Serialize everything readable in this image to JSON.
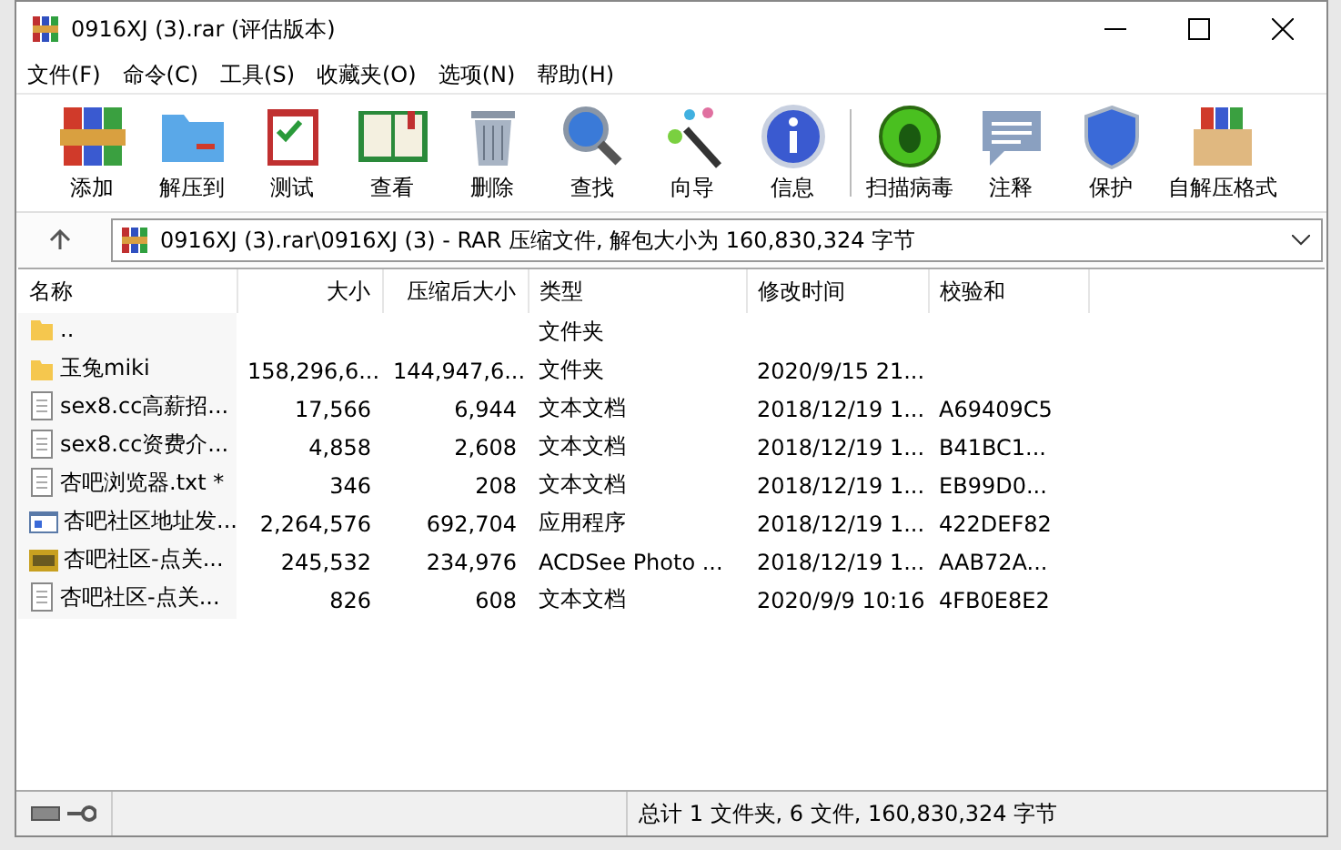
{
  "window": {
    "title": "0916XJ (3).rar (评估版本)"
  },
  "menu": [
    "文件(F)",
    "命令(C)",
    "工具(S)",
    "收藏夹(O)",
    "选项(N)",
    "帮助(H)"
  ],
  "toolbar": [
    {
      "label": "添加",
      "kind": "add"
    },
    {
      "label": "解压到",
      "kind": "extract"
    },
    {
      "label": "测试",
      "kind": "test"
    },
    {
      "label": "查看",
      "kind": "view"
    },
    {
      "label": "删除",
      "kind": "delete"
    },
    {
      "label": "查找",
      "kind": "find"
    },
    {
      "label": "向导",
      "kind": "wizard"
    },
    {
      "label": "信息",
      "kind": "info"
    },
    {
      "label": "扫描病毒",
      "kind": "scan"
    },
    {
      "label": "注释",
      "kind": "comment"
    },
    {
      "label": "保护",
      "kind": "protect"
    },
    {
      "label": "自解压格式",
      "kind": "sfx"
    }
  ],
  "address": {
    "value": "0916XJ (3).rar\\0916XJ (3) - RAR 压缩文件, 解包大小为 160,830,324 字节"
  },
  "table": {
    "columns": [
      "名称",
      "大小",
      "压缩后大小",
      "类型",
      "修改时间",
      "校验和"
    ],
    "rows": [
      {
        "kind": "folder",
        "name": "..",
        "size": "",
        "packed": "",
        "type": "文件夹",
        "modified": "",
        "crc": ""
      },
      {
        "kind": "folder",
        "name": "玉兔miki",
        "size": "158,296,6...",
        "packed": "144,947,6...",
        "type": "文件夹",
        "modified": "2020/9/15 21...",
        "crc": ""
      },
      {
        "kind": "text",
        "name": "sex8.cc高薪招...",
        "size": "17,566",
        "packed": "6,944",
        "type": "文本文档",
        "modified": "2018/12/19 1...",
        "crc": "A69409C5"
      },
      {
        "kind": "text",
        "name": "sex8.cc资费介...",
        "size": "4,858",
        "packed": "2,608",
        "type": "文本文档",
        "modified": "2018/12/19 1...",
        "crc": "B41BC1..."
      },
      {
        "kind": "text",
        "name": "杏吧浏览器.txt *",
        "size": "346",
        "packed": "208",
        "type": "文本文档",
        "modified": "2018/12/19 1...",
        "crc": "EB99D0..."
      },
      {
        "kind": "app",
        "name": "杏吧社区地址发...",
        "size": "2,264,576",
        "packed": "692,704",
        "type": "应用程序",
        "modified": "2018/12/19 1...",
        "crc": "422DEF82"
      },
      {
        "kind": "image",
        "name": "杏吧社区-点关...",
        "size": "245,532",
        "packed": "234,976",
        "type": "ACDSee Photo ...",
        "modified": "2018/12/19 1...",
        "crc": "AAB72A..."
      },
      {
        "kind": "text",
        "name": "杏吧社区-点关...",
        "size": "826",
        "packed": "608",
        "type": "文本文档",
        "modified": "2020/9/9 10:16",
        "crc": "4FB0E8E2"
      }
    ]
  },
  "status_bar": {
    "summary": "总计 1 文件夹, 6 文件, 160,830,324 字节"
  }
}
